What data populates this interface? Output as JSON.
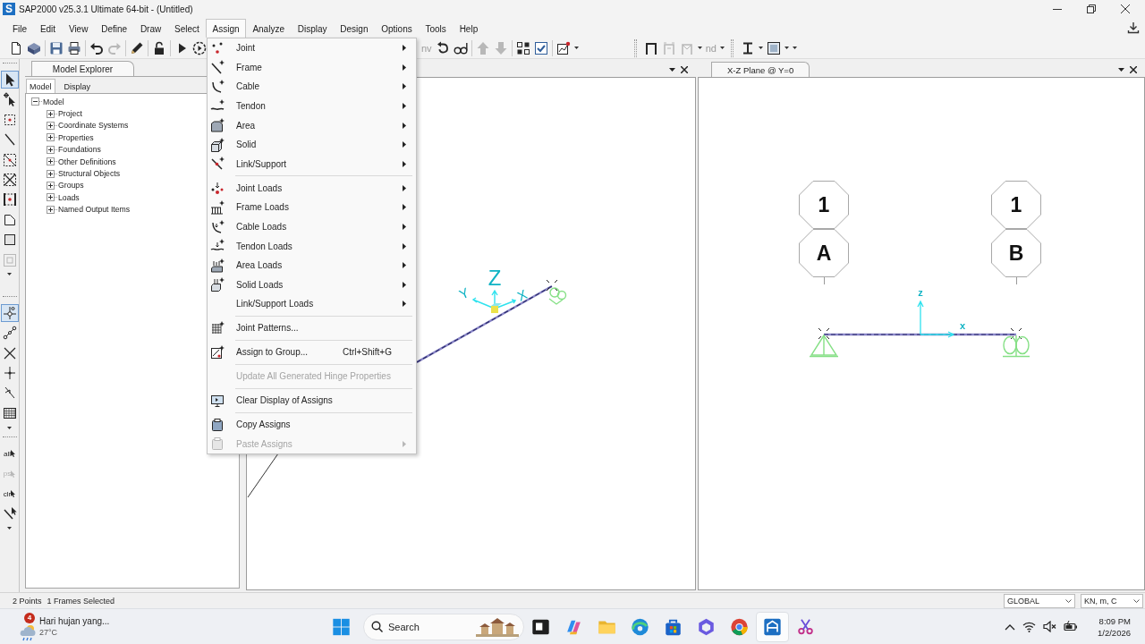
{
  "window": {
    "logo": "S",
    "title": "SAP2000 v25.3.1 Ultimate 64-bit - (Untitled)"
  },
  "menu_bar": [
    {
      "label": "File",
      "selected": false
    },
    {
      "label": "Edit",
      "selected": false
    },
    {
      "label": "View",
      "selected": false
    },
    {
      "label": "Define",
      "selected": false
    },
    {
      "label": "Draw",
      "selected": false
    },
    {
      "label": "Select",
      "selected": false
    },
    {
      "label": "Assign",
      "selected": true
    },
    {
      "label": "Analyze",
      "selected": false
    },
    {
      "label": "Display",
      "selected": false
    },
    {
      "label": "Design",
      "selected": false
    },
    {
      "label": "Options",
      "selected": false
    },
    {
      "label": "Tools",
      "selected": false
    },
    {
      "label": "Help",
      "selected": false
    }
  ],
  "toolbar": {
    "left": [
      {
        "disabled": false
      },
      {
        "disabled": false
      },
      {
        "disabled": false
      },
      {
        "disabled": false
      },
      {
        "disabled": false
      },
      {
        "disabled": true
      },
      {
        "disabled": false
      },
      {
        "disabled": false
      },
      {
        "disabled": false
      },
      {
        "disabled": false
      }
    ],
    "right": [
      {
        "label": "nv",
        "disabled": true
      },
      {
        "disabled": false
      },
      {
        "disabled": false
      },
      {
        "disabled": true
      },
      {
        "disabled": true
      },
      {
        "disabled": false
      },
      {
        "disabled": false
      },
      {
        "disabled": false
      },
      {
        "disabled": false
      },
      {
        "disabled": true
      },
      {
        "disabled": true
      },
      {
        "label": "nd",
        "disabled": true
      },
      {
        "disabled": false
      },
      {
        "disabled": false
      }
    ]
  },
  "side_toolbar": [
    {
      "items": [
        {
          "selected": true,
          "disabled": false
        },
        {
          "selected": false,
          "disabled": false
        },
        {
          "selected": false,
          "disabled": false
        },
        {
          "selected": false,
          "disabled": false
        },
        {
          "selected": false,
          "disabled": false
        },
        {
          "selected": false,
          "disabled": false
        },
        {
          "selected": false,
          "disabled": false
        },
        {
          "selected": false,
          "disabled": false
        },
        {
          "selected": false,
          "disabled": false
        },
        {
          "selected": false,
          "disabled": true
        }
      ]
    },
    {
      "items": [
        {
          "selected": true,
          "disabled": false
        },
        {
          "selected": false,
          "disabled": false
        },
        {
          "selected": false,
          "disabled": false
        },
        {
          "selected": false,
          "disabled": false
        },
        {
          "selected": false,
          "disabled": false
        },
        {
          "selected": false,
          "disabled": false
        }
      ]
    },
    {
      "items": [
        {
          "label": "all",
          "selected": false,
          "disabled": false
        },
        {
          "label": "ps",
          "selected": false,
          "disabled": true
        },
        {
          "label": "clr",
          "selected": false,
          "disabled": false
        },
        {
          "selected": false,
          "disabled": false
        }
      ]
    }
  ],
  "model_explorer": {
    "title": "Model Explorer",
    "tabs": [
      {
        "label": "Model",
        "selected": true
      },
      {
        "label": "Display",
        "selected": false
      }
    ],
    "tree": [
      {
        "label": "Model",
        "expanded": true,
        "children": [
          {
            "label": "Project",
            "expanded": false
          },
          {
            "label": "Coordinate Systems",
            "expanded": false
          },
          {
            "label": "Properties",
            "expanded": false
          },
          {
            "label": "Foundations",
            "expanded": false
          },
          {
            "label": "Other Definitions",
            "expanded": false
          },
          {
            "label": "Structural Objects",
            "expanded": false
          },
          {
            "label": "Groups",
            "expanded": false
          },
          {
            "label": "Loads",
            "expanded": false
          },
          {
            "label": "Named Output Items",
            "expanded": false
          }
        ]
      }
    ]
  },
  "left_view": {
    "axis_labels": [
      "Z",
      "Y",
      "X"
    ]
  },
  "right_view": {
    "title": "X-Z Plane @ Y=0",
    "grid_bubbles": [
      [
        "1",
        "A"
      ],
      [
        "1",
        "B"
      ]
    ],
    "axis_labels": [
      "z",
      "x"
    ]
  },
  "assign_menu": {
    "groups": [
      {
        "items": [
          {
            "label": "Joint",
            "submenu": true,
            "disabled": false
          },
          {
            "label": "Frame",
            "submenu": true,
            "disabled": false
          },
          {
            "label": "Cable",
            "submenu": true,
            "disabled": false
          },
          {
            "label": "Tendon",
            "submenu": true,
            "disabled": false
          },
          {
            "label": "Area",
            "submenu": true,
            "disabled": false
          },
          {
            "label": "Solid",
            "submenu": true,
            "disabled": false
          },
          {
            "label": "Link/Support",
            "submenu": true,
            "disabled": false
          }
        ]
      },
      {
        "items": [
          {
            "label": "Joint Loads",
            "submenu": true,
            "disabled": false
          },
          {
            "label": "Frame Loads",
            "submenu": true,
            "disabled": false
          },
          {
            "label": "Cable Loads",
            "submenu": true,
            "disabled": false
          },
          {
            "label": "Tendon Loads",
            "submenu": true,
            "disabled": false
          },
          {
            "label": "Area Loads",
            "submenu": true,
            "disabled": false
          },
          {
            "label": "Solid Loads",
            "submenu": true,
            "disabled": false
          },
          {
            "label": "Link/Support Loads",
            "submenu": true,
            "disabled": false
          }
        ]
      },
      {
        "items": [
          {
            "label": "Joint Patterns...",
            "submenu": false,
            "disabled": false
          }
        ]
      },
      {
        "items": [
          {
            "label": "Assign to Group...",
            "shortcut": "Ctrl+Shift+G",
            "submenu": false,
            "disabled": false
          }
        ]
      },
      {
        "items": [
          {
            "label": "Update All Generated Hinge Properties",
            "submenu": false,
            "disabled": true
          }
        ]
      },
      {
        "items": [
          {
            "label": "Clear Display of Assigns",
            "submenu": false,
            "disabled": false
          }
        ]
      },
      {
        "items": [
          {
            "label": "Copy Assigns",
            "submenu": false,
            "disabled": false
          },
          {
            "label": "Paste Assigns",
            "submenu": true,
            "disabled": true
          }
        ]
      }
    ]
  },
  "status_bar": {
    "selection": [
      "2 Points",
      "1 Frames Selected"
    ],
    "coordinate_system": "GLOBAL",
    "units": "KN, m, C"
  },
  "taskbar": {
    "weather": {
      "badge": "4",
      "text": "Hari hujan yang...",
      "temperature": "27°C"
    },
    "search": {
      "placeholder": "Search"
    },
    "apps": [
      {
        "selected": false
      },
      {
        "selected": false
      },
      {
        "selected": false
      },
      {
        "selected": false
      },
      {
        "selected": false
      },
      {
        "selected": false
      },
      {
        "selected": false
      },
      {
        "selected": true
      },
      {
        "selected": false
      }
    ],
    "clock": {
      "time": "8:09 PM",
      "date": "1/2/2026"
    }
  }
}
